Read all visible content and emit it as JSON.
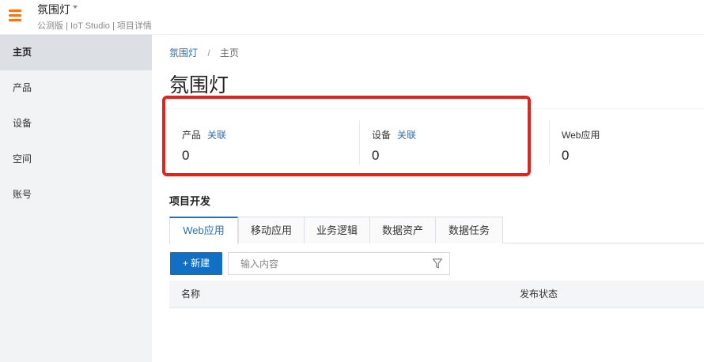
{
  "header": {
    "project_name": "氛围灯",
    "subtitle": "公测版 | IoT Studio | 项目详情"
  },
  "sidebar": {
    "items": [
      {
        "label": "主页",
        "active": true
      },
      {
        "label": "产品",
        "active": false
      },
      {
        "label": "设备",
        "active": false
      },
      {
        "label": "空间",
        "active": false
      },
      {
        "label": "账号",
        "active": false
      }
    ]
  },
  "breadcrumb": {
    "root": "氛围灯",
    "separator": "/",
    "current": "主页"
  },
  "page": {
    "title": "氛围灯"
  },
  "stats": [
    {
      "label": "产品",
      "link": "关联",
      "value": "0"
    },
    {
      "label": "设备",
      "link": "关联",
      "value": "0"
    },
    {
      "label": "Web应用",
      "link": "",
      "value": "0"
    }
  ],
  "dev": {
    "section_title": "项目开发",
    "tabs": [
      {
        "label": "Web应用",
        "active": true
      },
      {
        "label": "移动应用",
        "active": false
      },
      {
        "label": "业务逻辑",
        "active": false
      },
      {
        "label": "数据资产",
        "active": false
      },
      {
        "label": "数据任务",
        "active": false
      }
    ],
    "new_button": "+ 新建",
    "search_placeholder": "输入内容",
    "table_headers": [
      "名称",
      "发布状态"
    ]
  },
  "colors": {
    "accent": "#1170c4",
    "link": "#2b6fb6",
    "menu_icon": "#f5731e",
    "highlight": "#e5231b",
    "sidebar_bg": "#f2f3f5"
  }
}
